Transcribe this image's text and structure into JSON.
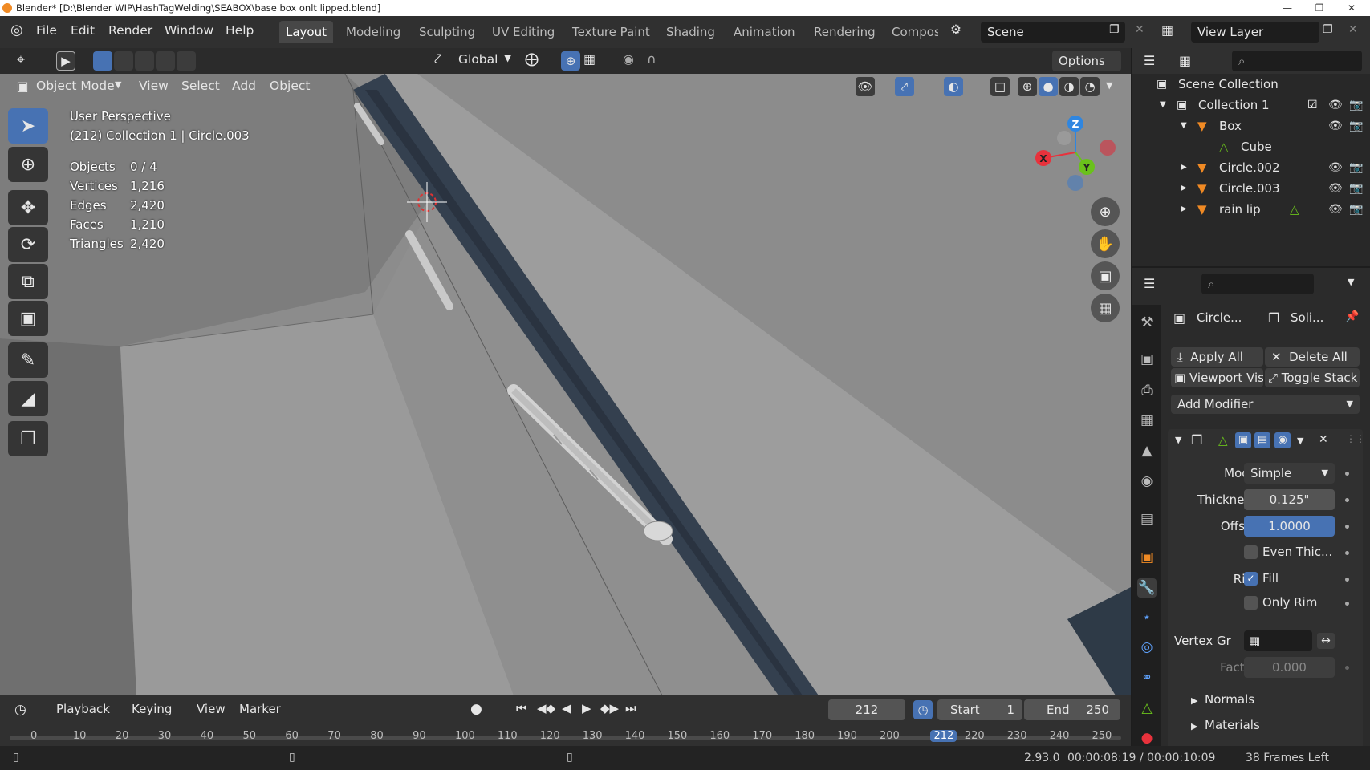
{
  "title_bar": {
    "text": "Blender* [D:\\Blender WIP\\HashTagWelding\\SEABOX\\base box onlt lipped.blend]"
  },
  "menu": [
    "File",
    "Edit",
    "Render",
    "Window",
    "Help"
  ],
  "workspaces": [
    "Layout",
    "Modeling",
    "Sculpting",
    "UV Editing",
    "Texture Paint",
    "Shading",
    "Animation",
    "Rendering",
    "Compos"
  ],
  "scene": "Scene",
  "view_layer": "View Layer",
  "header": {
    "transform": "Global",
    "options": "Options"
  },
  "viewport_header": {
    "mode": "Object Mode",
    "menus": [
      "View",
      "Select",
      "Add",
      "Object"
    ]
  },
  "overlay": {
    "perspective": "User Perspective",
    "collection": "(212) Collection 1 | Circle.003",
    "stats": [
      {
        "label": "Objects",
        "value": "0 / 4"
      },
      {
        "label": "Vertices",
        "value": "1,216"
      },
      {
        "label": "Edges",
        "value": "2,420"
      },
      {
        "label": "Faces",
        "value": "1,210"
      },
      {
        "label": "Triangles",
        "value": "2,420"
      }
    ]
  },
  "gizmo": {
    "x": "X",
    "y": "Y",
    "z": "Z"
  },
  "outliner": {
    "scene_collection": "Scene Collection",
    "items": [
      {
        "name": "Collection 1"
      },
      {
        "name": "Box"
      },
      {
        "name": "Cube"
      },
      {
        "name": "Circle.002"
      },
      {
        "name": "Circle.003"
      },
      {
        "name": "rain lip"
      }
    ]
  },
  "properties": {
    "object_name": "Circle...",
    "modifier_name": "Soli...",
    "apply_all": "Apply All",
    "delete_all": "Delete All",
    "viewport_vis": "Viewport Vis",
    "toggle_stack": "Toggle Stack",
    "add_modifier": "Add Modifier",
    "mode_label": "Mode",
    "mode_value": "Simple",
    "thickness_label": "Thickness",
    "thickness_value": "0.125\"",
    "offset_label": "Offset",
    "offset_value": "1.0000",
    "even_thickness": "Even Thic...",
    "rim_label": "Rim",
    "fill": "Fill",
    "only_rim": "Only Rim",
    "vertex_group_label": "Vertex Gr",
    "factor_label": "Factor",
    "factor_value": "0.000",
    "normals": "Normals",
    "materials": "Materials"
  },
  "timeline": {
    "menus": [
      "Playback",
      "Keying",
      "View",
      "Marker"
    ],
    "current_frame": "212",
    "start_label": "Start",
    "start_value": "1",
    "end_label": "End",
    "end_value": "250",
    "ticks": [
      "0",
      "10",
      "20",
      "30",
      "40",
      "50",
      "60",
      "70",
      "80",
      "90",
      "100",
      "110",
      "120",
      "130",
      "140",
      "150",
      "160",
      "170",
      "180",
      "190",
      "200",
      "212",
      "220",
      "230",
      "240",
      "250"
    ]
  },
  "status": {
    "version": "2.93.0",
    "time": "00:00:08:19 / 00:00:10:09",
    "frames_left": "38 Frames Left"
  },
  "colors": {
    "accent": "#4772b3",
    "x_axis": "#e8323c",
    "y_axis": "#6ac11b",
    "z_axis": "#2f86e0",
    "object": "#f08a24"
  }
}
